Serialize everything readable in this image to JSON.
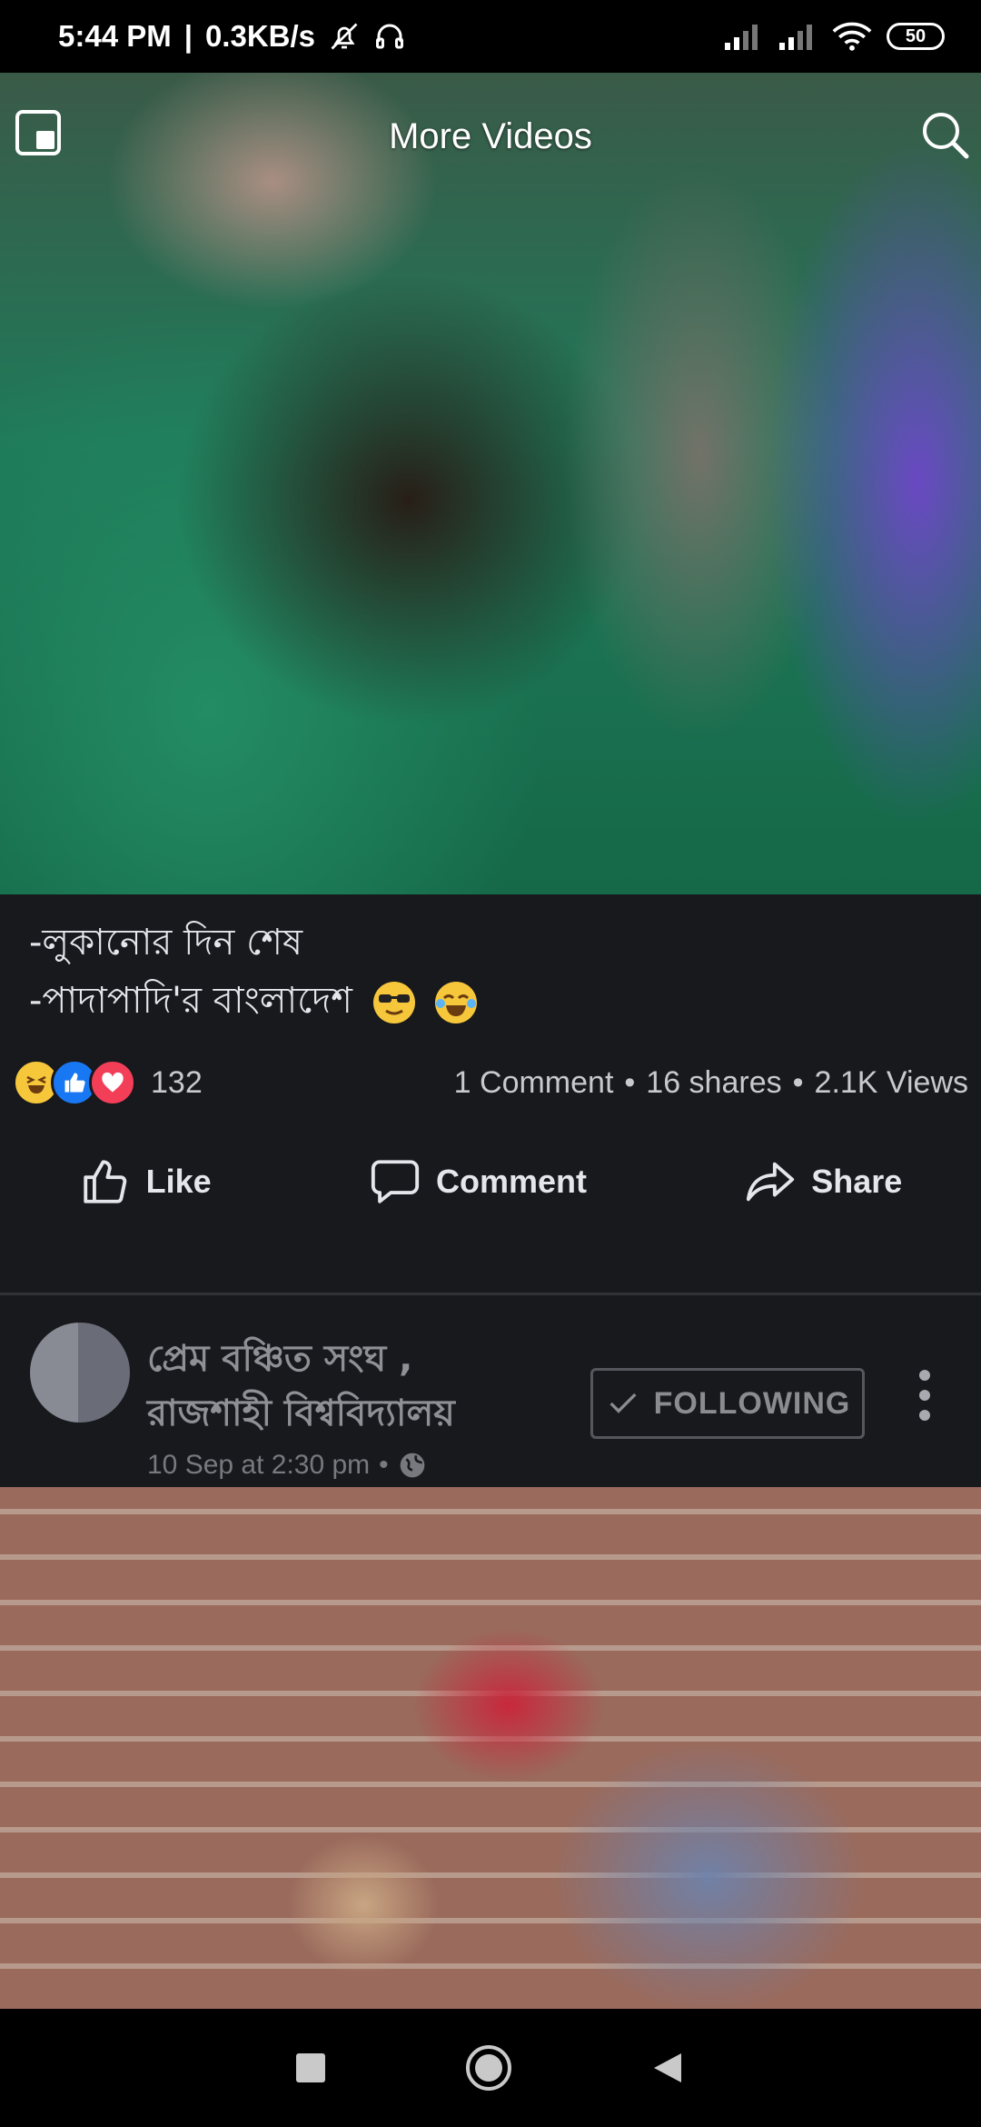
{
  "status_bar": {
    "time": "5:44 PM",
    "separator": "|",
    "net_speed": "0.3KB/s",
    "battery": "50"
  },
  "video_header": {
    "title": "More Videos"
  },
  "post1": {
    "caption_line1": "-লুকানোর দিন শেষ",
    "caption_line2": "-পাদাপাদি'র বাংলাদেশ",
    "reaction_count": "132",
    "comments": "1 Comment",
    "shares": "16 shares",
    "views": "2.1K Views",
    "dot": "•",
    "actions": {
      "like": "Like",
      "comment": "Comment",
      "share": "Share"
    }
  },
  "post2": {
    "page_name_line1": "প্রেম বঞ্চিত সংঘ ,",
    "page_name_line2": "রাজশাহী বিশ্ববিদ্যালয়",
    "follow_label": "FOLLOWING",
    "timestamp": "10 Sep at 2:30 pm",
    "dot": "•"
  },
  "colors": {
    "background": "#18191d",
    "like_blue": "#1877f2",
    "love_red": "#f33e58",
    "haha_yellow": "#f7c73b"
  },
  "icons": [
    "pip-icon",
    "search-icon",
    "haha-reaction-icon",
    "like-reaction-icon",
    "love-reaction-icon",
    "thumbs-up-icon",
    "comment-icon",
    "share-icon",
    "check-icon",
    "more-vertical-icon",
    "globe-icon",
    "square-icon",
    "circle-icon",
    "triangle-back-icon"
  ]
}
